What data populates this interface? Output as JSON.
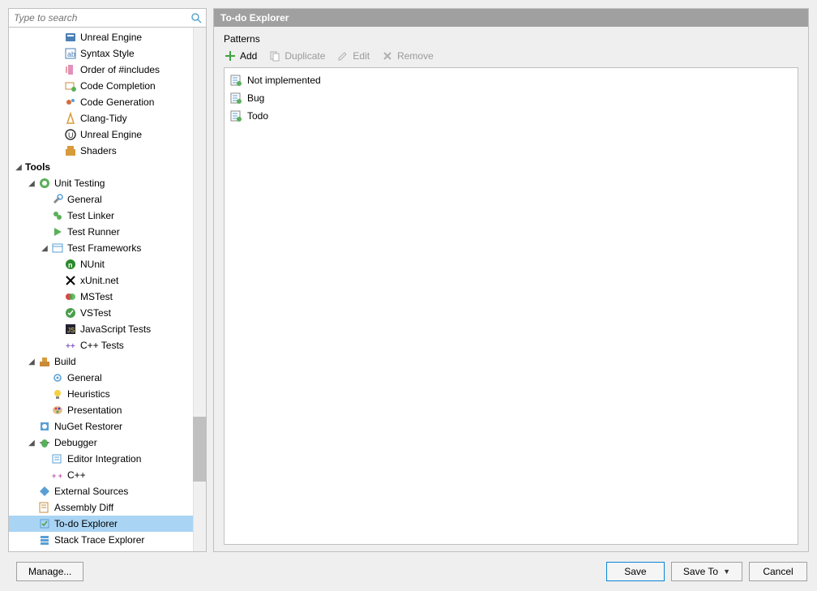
{
  "search": {
    "placeholder": "Type to search"
  },
  "header": {
    "title": "To-do Explorer"
  },
  "patterns": {
    "section_label": "Patterns",
    "toolbar": {
      "add": "Add",
      "duplicate": "Duplicate",
      "edit": "Edit",
      "remove": "Remove"
    },
    "items": [
      {
        "name": "Not implemented"
      },
      {
        "name": "Bug"
      },
      {
        "name": "Todo"
      }
    ]
  },
  "footer": {
    "manage": "Manage...",
    "save": "Save",
    "save_to": "Save To",
    "cancel": "Cancel"
  },
  "tree": [
    {
      "indent": 3,
      "icon": "unreal",
      "label": "Unreal Engine"
    },
    {
      "indent": 3,
      "icon": "syntax",
      "label": "Syntax Style"
    },
    {
      "indent": 3,
      "icon": "order",
      "label": "Order of #includes"
    },
    {
      "indent": 3,
      "icon": "completion",
      "label": "Code Completion"
    },
    {
      "indent": 3,
      "icon": "generation",
      "label": "Code Generation"
    },
    {
      "indent": 3,
      "icon": "clang",
      "label": "Clang-Tidy"
    },
    {
      "indent": 3,
      "icon": "ue",
      "label": "Unreal Engine"
    },
    {
      "indent": 3,
      "icon": "shaders",
      "label": "Shaders"
    },
    {
      "indent": 0,
      "expander": "expanded",
      "bold": true,
      "label": "Tools"
    },
    {
      "indent": 1,
      "expander": "expanded",
      "icon": "unittest",
      "label": "Unit Testing"
    },
    {
      "indent": 2,
      "icon": "wrench",
      "label": "General"
    },
    {
      "indent": 2,
      "icon": "linker",
      "label": "Test Linker"
    },
    {
      "indent": 2,
      "icon": "runner",
      "label": "Test Runner"
    },
    {
      "indent": 2,
      "expander": "expanded",
      "icon": "frameworks",
      "label": "Test Frameworks"
    },
    {
      "indent": 3,
      "icon": "nunit",
      "label": "NUnit"
    },
    {
      "indent": 3,
      "icon": "xunit",
      "label": "xUnit.net"
    },
    {
      "indent": 3,
      "icon": "mstest",
      "label": "MSTest"
    },
    {
      "indent": 3,
      "icon": "vstest",
      "label": "VSTest"
    },
    {
      "indent": 3,
      "icon": "js",
      "label": "JavaScript Tests"
    },
    {
      "indent": 3,
      "icon": "cpp",
      "label": "C++ Tests"
    },
    {
      "indent": 1,
      "expander": "expanded",
      "icon": "build",
      "label": "Build"
    },
    {
      "indent": 2,
      "icon": "gear",
      "label": "General"
    },
    {
      "indent": 2,
      "icon": "bulb",
      "label": "Heuristics"
    },
    {
      "indent": 2,
      "icon": "palette",
      "label": "Presentation"
    },
    {
      "indent": 1,
      "icon": "nuget",
      "label": "NuGet Restorer"
    },
    {
      "indent": 1,
      "expander": "expanded",
      "icon": "debugger",
      "label": "Debugger"
    },
    {
      "indent": 2,
      "icon": "editor",
      "label": "Editor Integration"
    },
    {
      "indent": 2,
      "icon": "cppplus",
      "label": "C++"
    },
    {
      "indent": 1,
      "icon": "external",
      "label": "External Sources"
    },
    {
      "indent": 1,
      "icon": "diff",
      "label": "Assembly Diff"
    },
    {
      "indent": 1,
      "icon": "todo",
      "label": "To-do Explorer",
      "selected": true
    },
    {
      "indent": 1,
      "icon": "stack",
      "label": "Stack Trace Explorer"
    }
  ]
}
